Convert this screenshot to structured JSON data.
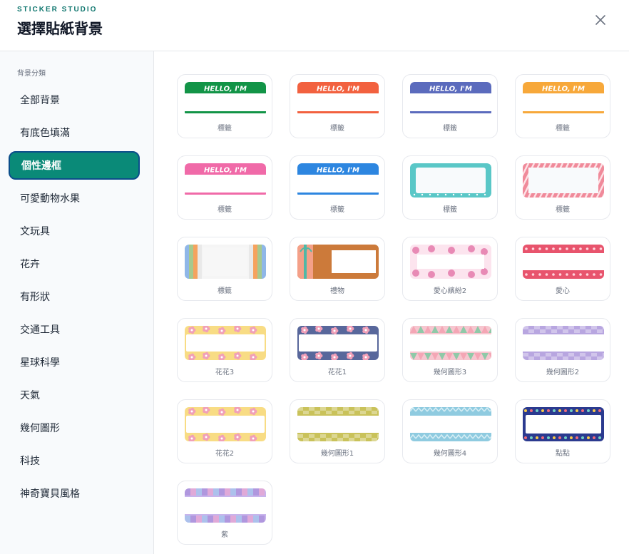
{
  "header": {
    "brand": "STICKER STUDIO",
    "title": "選擇貼紙背景",
    "close_icon": "close-icon"
  },
  "sidebar": {
    "label": "背景分類",
    "items": [
      {
        "label": "全部背景"
      },
      {
        "label": "有底色填滿"
      },
      {
        "label": "個性邊框",
        "active": true
      },
      {
        "label": "可愛動物水果"
      },
      {
        "label": "文玩具"
      },
      {
        "label": "花卉"
      },
      {
        "label": "有形狀"
      },
      {
        "label": "交通工具"
      },
      {
        "label": "星球科學"
      },
      {
        "label": "天氣"
      },
      {
        "label": "幾何圖形"
      },
      {
        "label": "科技"
      },
      {
        "label": "神奇寶貝風格"
      }
    ]
  },
  "cards": [
    {
      "label": "標籤",
      "style": "hello",
      "color": "#129447",
      "text": "HELLO, I'M"
    },
    {
      "label": "標籤",
      "style": "hello",
      "color": "#f2613f",
      "text": "HELLO, I'M"
    },
    {
      "label": "標籤",
      "style": "hello",
      "color": "#5b6bbd",
      "text": "HELLO, I'M"
    },
    {
      "label": "標籤",
      "style": "hello",
      "color": "#f7a83a",
      "text": "HELLO, I'M"
    },
    {
      "label": "標籤",
      "style": "hello",
      "color": "#f06aa8",
      "text": "HELLO, I'M"
    },
    {
      "label": "標籤",
      "style": "hello",
      "color": "#2d86e0",
      "text": "HELLO, I'M"
    },
    {
      "label": "標籤",
      "style": "frame",
      "color": "#5ac7c7"
    },
    {
      "label": "標籤",
      "style": "diag",
      "color": "#f08a9a"
    },
    {
      "label": "標籤",
      "style": "stripes"
    },
    {
      "label": "禮物",
      "style": "gift"
    },
    {
      "label": "愛心繽紛2",
      "style": "hearts2"
    },
    {
      "label": "愛心",
      "style": "hearts"
    },
    {
      "label": "花花3",
      "style": "flower",
      "color": "#f8dc84"
    },
    {
      "label": "花花1",
      "style": "flower",
      "color": "#58679b"
    },
    {
      "label": "幾何圖形3",
      "style": "geo3"
    },
    {
      "label": "幾何圖形2",
      "style": "checker",
      "color": "#b8a6e0"
    },
    {
      "label": "花花2",
      "style": "flower",
      "color": "#f8dc84"
    },
    {
      "label": "幾何圖形1",
      "style": "checker",
      "color": "#c9c25a"
    },
    {
      "label": "幾何圖形4",
      "style": "zigzag"
    },
    {
      "label": "點點",
      "style": "dots"
    },
    {
      "label": "紫",
      "style": "purple"
    }
  ]
}
